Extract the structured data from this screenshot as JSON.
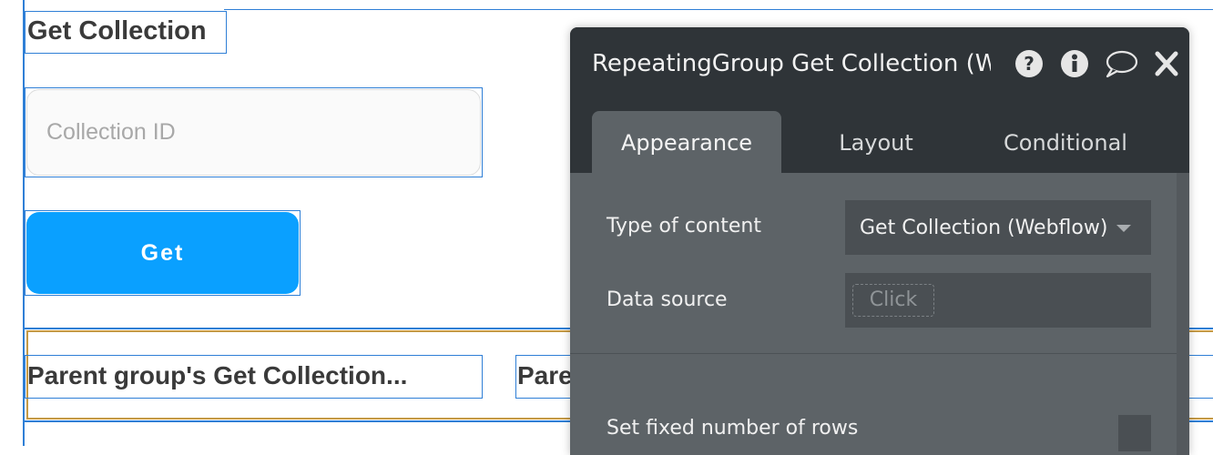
{
  "canvas": {
    "title": "Get Collection",
    "input_placeholder": "Collection ID",
    "button_label": "Get",
    "group_cells": [
      "Parent group's Get Collection...",
      "Pare"
    ]
  },
  "panel": {
    "title": "RepeatingGroup Get Collection (W",
    "header_icons": [
      "question-icon",
      "info-icon",
      "comment-icon",
      "close-icon"
    ],
    "tabs": [
      {
        "label": "Appearance",
        "active": true
      },
      {
        "label": "Layout",
        "active": false
      },
      {
        "label": "Conditional",
        "active": false
      }
    ],
    "properties": {
      "type_of_content_label": "Type of content",
      "type_of_content_value": "Get Collection (Webflow)",
      "data_source_label": "Data source",
      "data_source_placeholder": "Click",
      "fixed_rows_label": "Set fixed number of rows"
    }
  },
  "colors": {
    "selection_blue": "#2f7fd6",
    "button_blue": "#0aa0ff",
    "group_orange": "#c59a45",
    "panel_dark": "#2f3438",
    "panel_body": "#5d6367"
  }
}
